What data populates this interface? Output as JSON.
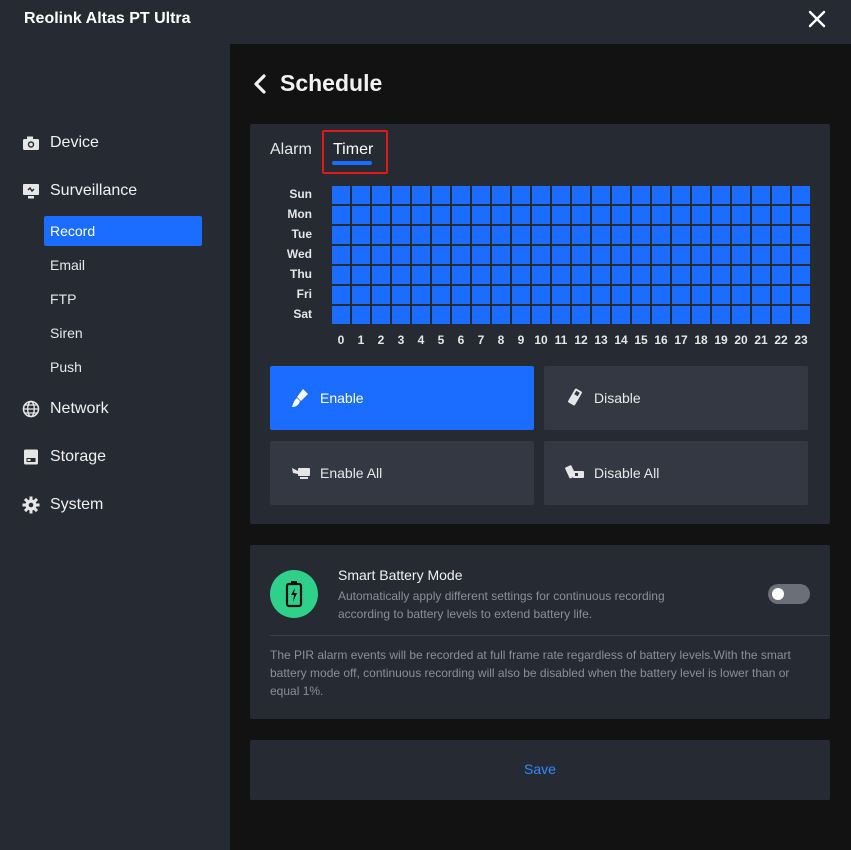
{
  "window": {
    "title": "Reolink Altas PT Ultra"
  },
  "sidebar": {
    "items": [
      {
        "label": "Device",
        "icon": "camera-icon"
      },
      {
        "label": "Surveillance",
        "icon": "monitor-icon"
      },
      {
        "label": "Network",
        "icon": "globe-icon"
      },
      {
        "label": "Storage",
        "icon": "storage-icon"
      },
      {
        "label": "System",
        "icon": "gear-icon"
      }
    ],
    "sub_items": [
      {
        "label": "Record",
        "active": true
      },
      {
        "label": "Email"
      },
      {
        "label": "FTP"
      },
      {
        "label": "Siren"
      },
      {
        "label": "Push"
      }
    ]
  },
  "page": {
    "title": "Schedule"
  },
  "schedule": {
    "tabs": [
      "Alarm",
      "Timer"
    ],
    "active_tab": "Timer",
    "days": [
      "Sun",
      "Mon",
      "Tue",
      "Wed",
      "Thu",
      "Fri",
      "Sat"
    ],
    "hours": [
      "0",
      "1",
      "2",
      "3",
      "4",
      "5",
      "6",
      "7",
      "8",
      "9",
      "10",
      "11",
      "12",
      "13",
      "14",
      "15",
      "16",
      "17",
      "18",
      "19",
      "20",
      "21",
      "22",
      "23"
    ],
    "all_cells_enabled": true,
    "enabled_color": "#1a6dff",
    "buttons": {
      "enable": "Enable",
      "disable": "Disable",
      "enable_all": "Enable All",
      "disable_all": "Disable All"
    }
  },
  "battery": {
    "title": "Smart Battery Mode",
    "description": "Automatically apply different settings for continuous recording according to battery levels to extend battery life.",
    "toggle_on": false,
    "note": "The PIR alarm events will be recorded at full frame rate regardless of battery levels.With the smart battery mode off, continuous recording will also be disabled when the battery level is lower than or equal 1%.",
    "icon_color": "#2fd08a"
  },
  "footer": {
    "save_label": "Save"
  }
}
